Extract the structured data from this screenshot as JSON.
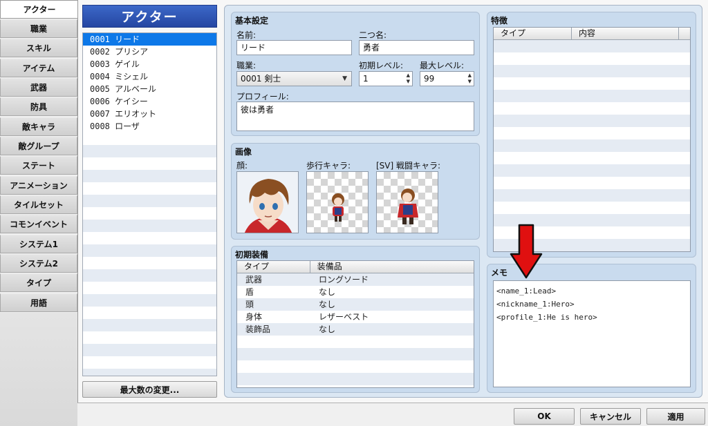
{
  "tabs": [
    {
      "label": "アクター",
      "active": true
    },
    {
      "label": "職業"
    },
    {
      "label": "スキル"
    },
    {
      "label": "アイテム"
    },
    {
      "label": "武器"
    },
    {
      "label": "防具"
    },
    {
      "label": "敵キャラ"
    },
    {
      "label": "敵グループ"
    },
    {
      "label": "ステート"
    },
    {
      "label": "アニメーション"
    },
    {
      "label": "タイルセット"
    },
    {
      "label": "コモンイベント"
    },
    {
      "label": "システム1"
    },
    {
      "label": "システム2"
    },
    {
      "label": "タイプ"
    },
    {
      "label": "用語"
    }
  ],
  "list": {
    "title": "アクター",
    "items": [
      {
        "label": "0001 リード",
        "selected": true
      },
      {
        "label": "0002 プリシア"
      },
      {
        "label": "0003 ゲイル"
      },
      {
        "label": "0004 ミシェル"
      },
      {
        "label": "0005 アルベール"
      },
      {
        "label": "0006 ケイシー"
      },
      {
        "label": "0007 エリオット"
      },
      {
        "label": "0008 ローザ"
      }
    ],
    "max_button": "最大数の変更..."
  },
  "basic": {
    "title": "基本設定",
    "name_label": "名前:",
    "name_value": "リード",
    "nickname_label": "二つ名:",
    "nickname_value": "勇者",
    "class_label": "職業:",
    "class_value": "0001 剣士",
    "initial_level_label": "初期レベル:",
    "initial_level_value": "1",
    "max_level_label": "最大レベル:",
    "max_level_value": "99",
    "profile_label": "プロフィール:",
    "profile_value": "彼は勇者"
  },
  "images": {
    "title": "画像",
    "face_label": "顔:",
    "walk_label": "歩行キャラ:",
    "battler_label": "[SV] 戦闘キャラ:"
  },
  "equip": {
    "title": "初期装備",
    "headers": [
      "タイプ",
      "装備品"
    ],
    "rows": [
      [
        "武器",
        "ロングソード"
      ],
      [
        "盾",
        "なし"
      ],
      [
        "頭",
        "なし"
      ],
      [
        "身体",
        "レザーベスト"
      ],
      [
        "装飾品",
        "なし"
      ]
    ]
  },
  "traits": {
    "title": "特徴",
    "headers": [
      "タイプ",
      "内容"
    ]
  },
  "memo": {
    "title": "メモ",
    "lines": [
      "<name_1:Lead>",
      "<nickname_1:Hero>",
      "<profile_1:He is hero>"
    ]
  },
  "buttons": {
    "ok": "OK",
    "cancel": "キャンセル",
    "apply": "適用"
  },
  "colors": {
    "accent": "#2546a2",
    "selection": "#0d78e8",
    "arrow": "#e01010"
  },
  "icons": [
    "dropdown-arrow-icon",
    "spin-arrows-icon",
    "red-down-arrow-icon"
  ]
}
